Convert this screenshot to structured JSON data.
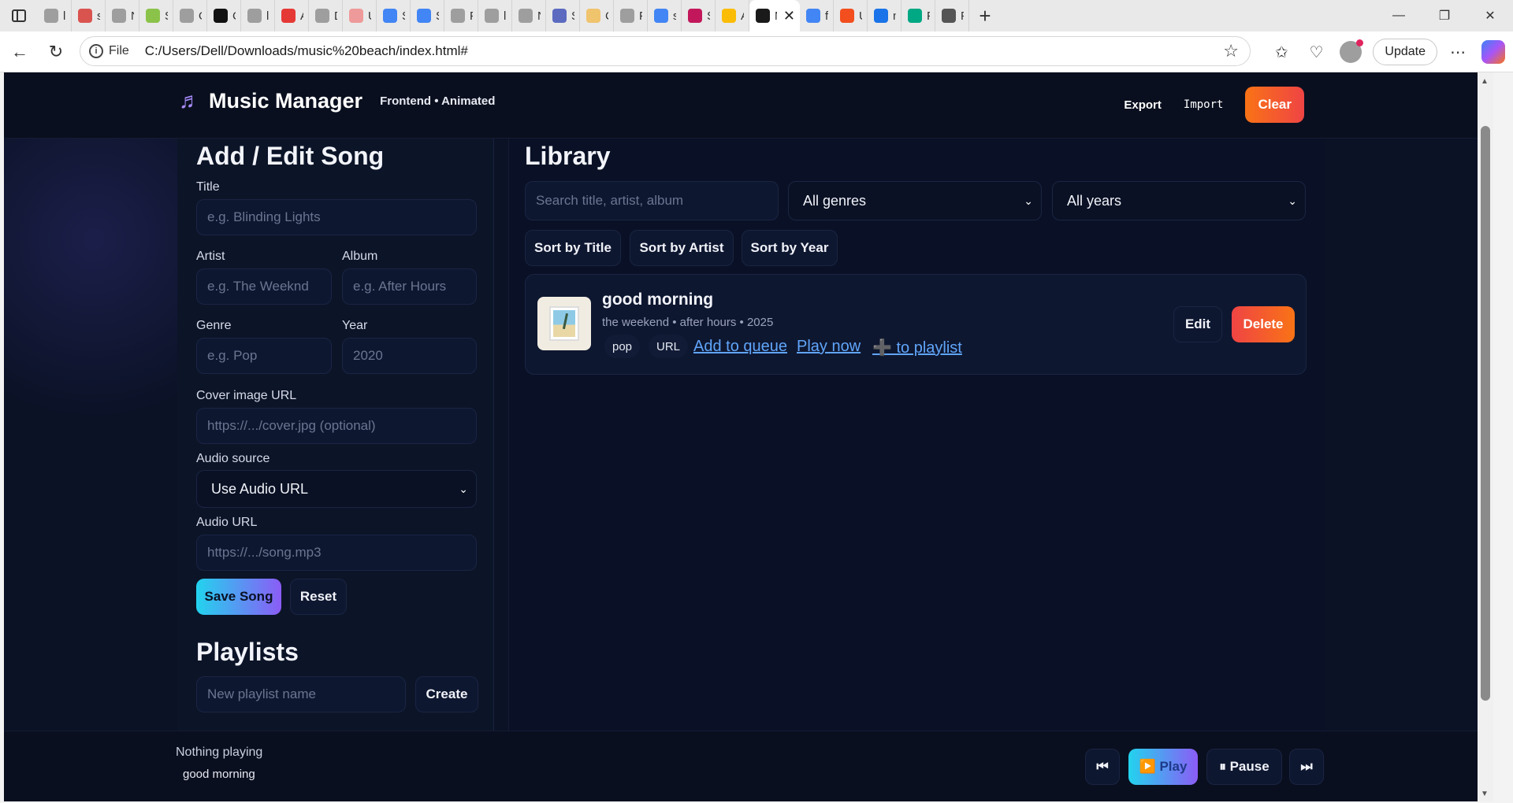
{
  "browser": {
    "tabs": [
      {
        "label": "loc",
        "color": "#9e9e9e"
      },
      {
        "label": "spi",
        "color": "#d9534f"
      },
      {
        "label": "Ne",
        "color": "#9e9e9e"
      },
      {
        "label": "Sp",
        "color": "#8bc34a"
      },
      {
        "label": "Ol",
        "color": "#9e9e9e"
      },
      {
        "label": "Cr",
        "color": "#111111"
      },
      {
        "label": "loc",
        "color": "#9e9e9e"
      },
      {
        "label": "An",
        "color": "#e53935"
      },
      {
        "label": "Dc",
        "color": "#9e9e9e"
      },
      {
        "label": "Ur",
        "color": "#ef9a9a"
      },
      {
        "label": "Sig",
        "color": "#4285f4"
      },
      {
        "label": "Sig",
        "color": "#4285f4"
      },
      {
        "label": "Po",
        "color": "#9e9e9e"
      },
      {
        "label": "loc",
        "color": "#9e9e9e"
      },
      {
        "label": "Ne",
        "color": "#9e9e9e"
      },
      {
        "label": "Se",
        "color": "#5c6bc0"
      },
      {
        "label": "Ca",
        "color": "#f0c36d"
      },
      {
        "label": "Pe",
        "color": "#9e9e9e"
      },
      {
        "label": "sti",
        "color": "#4285f4"
      },
      {
        "label": "Sti",
        "color": "#c2185b"
      },
      {
        "label": "AB",
        "color": "#fbbc05"
      }
    ],
    "active_tab": {
      "label": "Mu",
      "color": "#1a1a1a"
    },
    "tabs_after": [
      {
        "label": "fig",
        "color": "#4285f4"
      },
      {
        "label": "Ur",
        "color": "#f24e1e"
      },
      {
        "label": "ne",
        "color": "#1a73e8"
      },
      {
        "label": "Pr",
        "color": "#00a884"
      },
      {
        "label": "Pe",
        "color": "#555555"
      }
    ],
    "file_label": "File",
    "url": "C:/Users/Dell/Downloads/music%20beach/index.html#",
    "update_label": "Update"
  },
  "header": {
    "title": "Music Manager",
    "subtitle": "Frontend • Animated",
    "export_label": "Export",
    "import_label": "Import",
    "clear_label": "Clear"
  },
  "form": {
    "heading": "Add / Edit Song",
    "title_label": "Title",
    "title_placeholder": "e.g. Blinding Lights",
    "artist_label": "Artist",
    "artist_placeholder": "e.g. The Weeknd",
    "album_label": "Album",
    "album_placeholder": "e.g. After Hours",
    "genre_label": "Genre",
    "genre_placeholder": "e.g. Pop",
    "year_label": "Year",
    "year_placeholder": "2020",
    "cover_label": "Cover image URL",
    "cover_placeholder": "https://.../cover.jpg (optional)",
    "audio_source_label": "Audio source",
    "audio_source_value": "Use Audio URL",
    "audio_url_label": "Audio URL",
    "audio_url_placeholder": "https://.../song.mp3",
    "save_label": "Save Song",
    "reset_label": "Reset"
  },
  "playlists": {
    "heading": "Playlists",
    "name_placeholder": "New playlist name",
    "create_label": "Create"
  },
  "library": {
    "heading": "Library",
    "search_placeholder": "Search title, artist, album",
    "genre_filter": "All genres",
    "year_filter": "All years",
    "sort_title": "Sort by Title",
    "sort_artist": "Sort by Artist",
    "sort_year": "Sort by Year",
    "songs": [
      {
        "title": "good morning",
        "meta": "the weekend • after hours • 2025",
        "genre_chip": "pop",
        "source_chip": "URL",
        "add_queue": "Add to queue",
        "play_now": "Play now",
        "to_playlist": "➕ to playlist",
        "edit": "Edit",
        "delete": "Delete"
      }
    ]
  },
  "player": {
    "status": "Nothing playing",
    "queue_item": "good morning",
    "prev_icon": "⏮",
    "play_label": "▶️ Play",
    "pause_label": "⏸ Pause",
    "next_icon": "⏭"
  },
  "colors": {
    "page_bg": "#0b1226",
    "accent_gradient_start": "#22d3ee",
    "accent_gradient_end": "#8b5cf6",
    "danger": "#ef4444",
    "link": "#60a5fa"
  }
}
